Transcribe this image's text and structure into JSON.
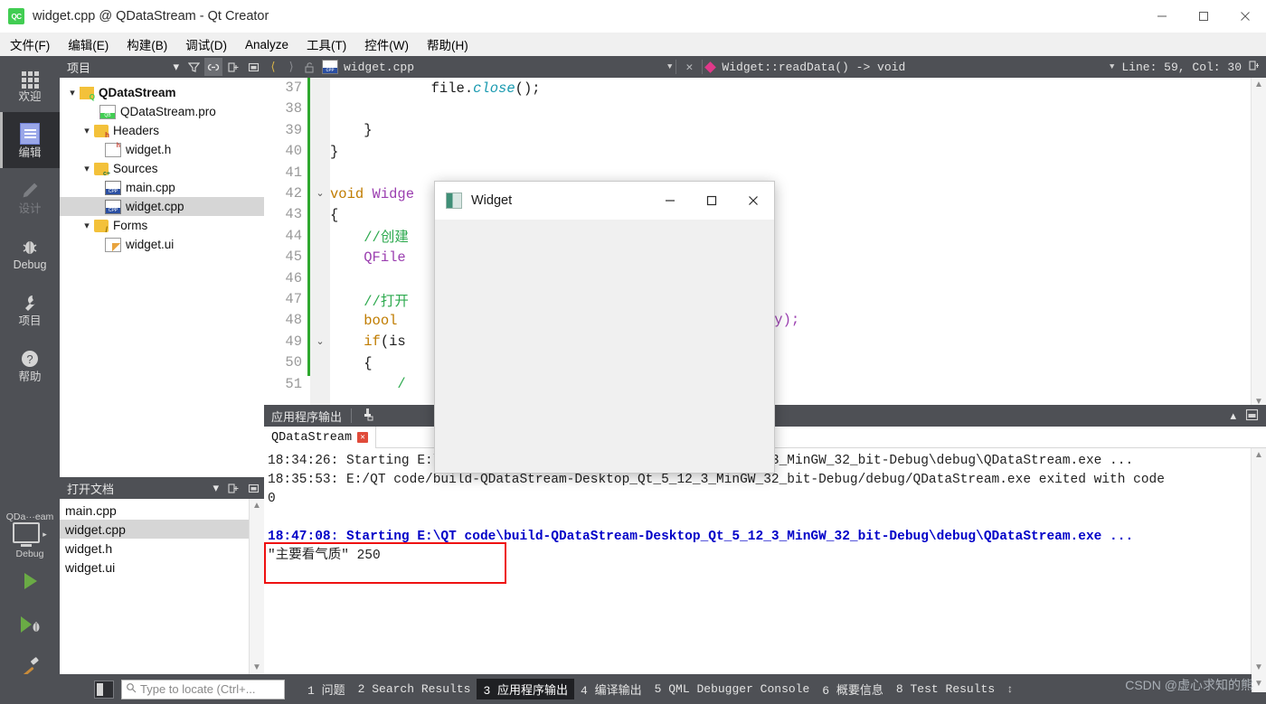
{
  "window": {
    "title": "widget.cpp @ QDataStream - Qt Creator",
    "app_icon_text": "QC",
    "minimize": "–",
    "maximize": "□",
    "close": "✕"
  },
  "menubar": {
    "items": [
      {
        "label": "文件(F)"
      },
      {
        "label": "编辑(E)"
      },
      {
        "label": "构建(B)"
      },
      {
        "label": "调试(D)"
      },
      {
        "label": "Analyze"
      },
      {
        "label": "工具(T)"
      },
      {
        "label": "控件(W)"
      },
      {
        "label": "帮助(H)"
      }
    ]
  },
  "activitybar": {
    "items": [
      {
        "label": "欢迎",
        "icon": "grid-icon",
        "state": "normal"
      },
      {
        "label": "编辑",
        "icon": "edit-icon",
        "state": "active"
      },
      {
        "label": "设计",
        "icon": "pencil-icon",
        "state": "disabled"
      },
      {
        "label": "Debug",
        "icon": "bug-icon",
        "state": "normal"
      },
      {
        "label": "项目",
        "icon": "wrench-icon",
        "state": "normal"
      },
      {
        "label": "帮助",
        "icon": "help-icon",
        "state": "normal"
      }
    ],
    "kit": {
      "project": "QDa···eam",
      "build_config": "Debug",
      "run_icon": "run-icon",
      "debug_icon": "run-debug-icon",
      "build_icon": "hammer-icon"
    }
  },
  "project_panel": {
    "title": "项目",
    "toolbar": [
      "filter-icon",
      "link-icon",
      "split-icon",
      "close-panel-icon"
    ],
    "tree": [
      {
        "label": "QDataStream",
        "indent": 0,
        "icon": "qt-project-icon",
        "bold": true,
        "expanded": true,
        "selected": false
      },
      {
        "label": "QDataStream.pro",
        "indent": 1,
        "icon": "pro-file-icon",
        "bold": false,
        "expanded": null,
        "selected": false
      },
      {
        "label": "Headers",
        "indent": 1,
        "icon": "folder-h-icon",
        "bold": false,
        "expanded": true,
        "selected": false
      },
      {
        "label": "widget.h",
        "indent": 2,
        "icon": "h-file-icon",
        "bold": false,
        "expanded": null,
        "selected": false
      },
      {
        "label": "Sources",
        "indent": 1,
        "icon": "folder-cpp-icon",
        "bold": false,
        "expanded": true,
        "selected": false
      },
      {
        "label": "main.cpp",
        "indent": 2,
        "icon": "cpp-file-icon",
        "bold": false,
        "expanded": null,
        "selected": false
      },
      {
        "label": "widget.cpp",
        "indent": 2,
        "icon": "cpp-file-icon",
        "bold": false,
        "expanded": null,
        "selected": true
      },
      {
        "label": "Forms",
        "indent": 1,
        "icon": "folder-form-icon",
        "bold": false,
        "expanded": true,
        "selected": false
      },
      {
        "label": "widget.ui",
        "indent": 2,
        "icon": "ui-file-icon",
        "bold": false,
        "expanded": null,
        "selected": false
      }
    ]
  },
  "open_documents": {
    "title": "打开文档",
    "toolbar": [
      "split-icon",
      "close-panel-icon"
    ],
    "files": [
      {
        "name": "main.cpp",
        "selected": false
      },
      {
        "name": "widget.cpp",
        "selected": true
      },
      {
        "name": "widget.h",
        "selected": false
      },
      {
        "name": "widget.ui",
        "selected": false
      }
    ]
  },
  "editor_toolbar": {
    "back_icon": "chevron-left-icon",
    "forward_icon": "chevron-right-icon",
    "lock_icon": "unlock-icon",
    "file_icon": "cpp-file-icon",
    "file_name": "widget.cpp",
    "close_icon": "✕",
    "symbol": "Widget::readData() -> void",
    "cursor_position": "Line: 59, Col: 30",
    "split_icon": "split-editor-icon"
  },
  "editor": {
    "lines": [
      {
        "num": "37",
        "fold": "",
        "tokens": [
          {
            "t": "            ",
            "c": "k-txt"
          },
          {
            "t": "file",
            "c": "k-txt"
          },
          {
            "t": ".",
            "c": "k-txt"
          },
          {
            "t": "close",
            "c": "k-fn"
          },
          {
            "t": "();",
            "c": "k-txt"
          }
        ]
      },
      {
        "num": "38",
        "fold": "",
        "tokens": []
      },
      {
        "num": "39",
        "fold": "",
        "tokens": [
          {
            "t": "    }",
            "c": "k-txt"
          }
        ]
      },
      {
        "num": "40",
        "fold": "",
        "tokens": [
          {
            "t": "}",
            "c": "k-txt"
          }
        ]
      },
      {
        "num": "41",
        "fold": "",
        "tokens": []
      },
      {
        "num": "42",
        "fold": "⌄",
        "tokens": [
          {
            "t": "void ",
            "c": "k-kw"
          },
          {
            "t": "Widge",
            "c": "k-type"
          }
        ]
      },
      {
        "num": "43",
        "fold": "",
        "tokens": [
          {
            "t": "{",
            "c": "k-txt"
          }
        ]
      },
      {
        "num": "44",
        "fold": "",
        "tokens": [
          {
            "t": "    ",
            "c": "k-txt"
          },
          {
            "t": "//创建",
            "c": "k-cmt"
          }
        ]
      },
      {
        "num": "45",
        "fold": "",
        "tokens": [
          {
            "t": "    ",
            "c": "k-txt"
          },
          {
            "t": "QFile",
            "c": "k-type"
          }
        ]
      },
      {
        "num": "46",
        "fold": "",
        "tokens": []
      },
      {
        "num": "47",
        "fold": "",
        "tokens": [
          {
            "t": "    ",
            "c": "k-txt"
          },
          {
            "t": "//打开",
            "c": "k-cmt"
          }
        ]
      },
      {
        "num": "48",
        "fold": "",
        "tokens": [
          {
            "t": "    ",
            "c": "k-txt"
          },
          {
            "t": "bool ",
            "c": "k-kw"
          }
        ]
      },
      {
        "num": "49",
        "fold": "⌄",
        "tokens": [
          {
            "t": "    ",
            "c": "k-txt"
          },
          {
            "t": "if",
            "c": "k-kw"
          },
          {
            "t": "(is",
            "c": "k-txt"
          }
        ]
      },
      {
        "num": "50",
        "fold": "",
        "tokens": [
          {
            "t": "    {",
            "c": "k-txt"
          }
        ]
      },
      {
        "num": "51",
        "fold": "",
        "tokens": [
          {
            "t": "        ",
            "c": "k-txt"
          },
          {
            "t": "/",
            "c": "k-cmt"
          }
        ]
      }
    ],
    "line48_tail": "ly);"
  },
  "widget_dialog": {
    "title": "Widget",
    "icon": "widget-app-icon",
    "minimize": "–",
    "maximize": "□",
    "close": "✕"
  },
  "output_pane": {
    "title": "应用程序输出",
    "clear_icon": "clear-output-icon",
    "minimize_icon": "chevron-up-icon",
    "maximize_icon": "maximize-pane-icon",
    "tabs": [
      {
        "label": "QDataStream",
        "close": "✕",
        "active": true
      }
    ],
    "lines": [
      {
        "text": "18:34:26: Starting E:\\QT code\\build-QDataStream-Desktop_Qt_5_12_3_MinGW_32_bit-Debug\\debug\\QDataStream.exe ...",
        "style": "normal"
      },
      {
        "text": "18:35:53: E:/QT code/build-QDataStream-Desktop_Qt_5_12_3_MinGW_32_bit-Debug/debug/QDataStream.exe exited with code",
        "style": "normal"
      },
      {
        "text": "0",
        "style": "normal"
      },
      {
        "text": "",
        "style": "normal"
      },
      {
        "text": "18:47:08: Starting E:\\QT code\\build-QDataStream-Desktop_Qt_5_12_3_MinGW_32_bit-Debug\\debug\\QDataStream.exe ...",
        "style": "blue"
      },
      {
        "text": "\"主要看气质\" 250",
        "style": "normal"
      }
    ]
  },
  "statusbar": {
    "toggle_sidebar_icon": "toggle-sidebar-icon",
    "locator_placeholder": "Type to locate (Ctrl+...",
    "search_icon": "search-icon",
    "items": [
      {
        "label": "1 问题",
        "active": false
      },
      {
        "label": "2 Search Results",
        "active": false
      },
      {
        "label": "3 应用程序输出",
        "active": true
      },
      {
        "label": "4 编译输出",
        "active": false
      },
      {
        "label": "5 QML Debugger Console",
        "active": false
      },
      {
        "label": "6 概要信息",
        "active": false
      },
      {
        "label": "8 Test Results",
        "active": false
      }
    ],
    "updown_icon": "↕"
  },
  "watermark": "CSDN @虚心求知的熊",
  "colors": {
    "chrome_dark": "#4e5055",
    "accent_green": "#41cd52",
    "selection_gray": "#d6d6d6",
    "console_blue": "#0000c8",
    "highlight_red": "#ee1111"
  }
}
